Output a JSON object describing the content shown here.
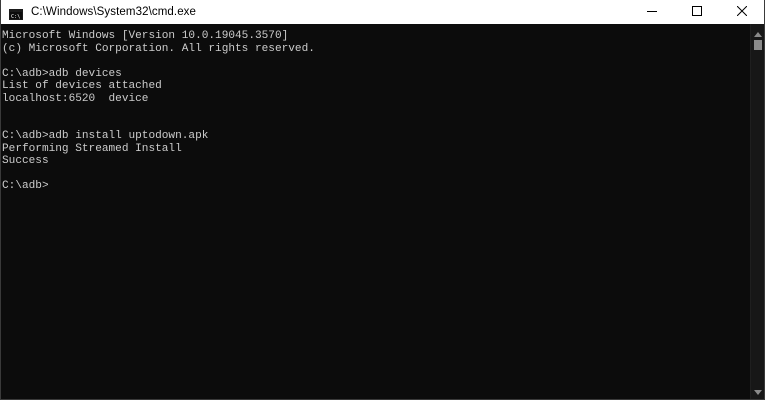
{
  "window": {
    "title": "C:\\Windows\\System32\\cmd.exe",
    "icon": "cmd-icon"
  },
  "controls": {
    "minimize_icon": "minimize-icon",
    "maximize_icon": "maximize-icon",
    "close_icon": "close-icon"
  },
  "console": {
    "lines": [
      "Microsoft Windows [Version 10.0.19045.3570]",
      "(c) Microsoft Corporation. All rights reserved.",
      "",
      "C:\\adb>adb devices",
      "List of devices attached",
      "localhost:6520  device",
      "",
      "",
      "C:\\adb>adb install uptodown.apk",
      "Performing Streamed Install",
      "Success",
      "",
      "C:\\adb>"
    ]
  },
  "colors": {
    "background": "#0c0c0c",
    "text": "#cccccc",
    "titlebar": "#ffffff"
  }
}
